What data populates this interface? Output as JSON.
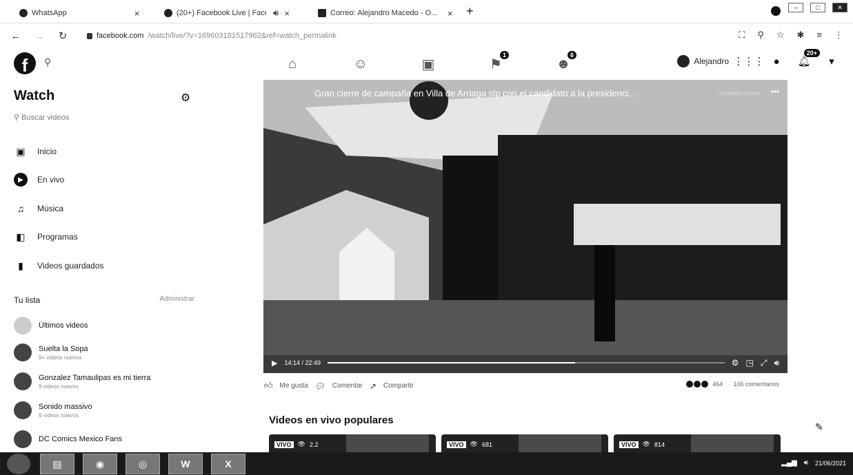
{
  "browser": {
    "tabs": [
      {
        "title": "WhatsApp",
        "close": "×"
      },
      {
        "title": "(20+) Facebook Live | Face",
        "close": "×"
      },
      {
        "title": "Correo: Alejandro Macedo - O...",
        "close": "×"
      }
    ],
    "new_tab": "+",
    "url_host": "facebook.com",
    "url_path": "/watch/live/?v=169603181517962&ref=watch_permalink"
  },
  "fb_nav": {
    "user_name": "Alejandro",
    "notification_badge": "20+",
    "groups_badge": "1",
    "gaming_badge": "6"
  },
  "sidebar": {
    "title": "Watch",
    "search_placeholder": "Buscar videos",
    "items": [
      {
        "label": "Inicio",
        "icon": "watch-home-icon"
      },
      {
        "label": "En vivo",
        "icon": "live-icon"
      },
      {
        "label": "Música",
        "icon": "music-icon"
      },
      {
        "label": "Programas",
        "icon": "shows-icon"
      },
      {
        "label": "Videos guardados",
        "icon": "bookmark-icon"
      }
    ],
    "your_list_label": "Tu lista",
    "manage_label": "Administrar",
    "list": [
      {
        "name": "Últimos videos",
        "sub": ""
      },
      {
        "name": "Suelta la Sopa",
        "sub": "9+ videos nuevos"
      },
      {
        "name": "Gonzalez Tamaulipas es mi tierra",
        "sub": "9 videos nuevos"
      },
      {
        "name": "Sonido massivo",
        "sub": "6 videos nuevos"
      },
      {
        "name": "DC Comics Mexico Fans",
        "sub": ""
      }
    ]
  },
  "video": {
    "title": "Gran cierre de campaña en Villa de Arriaga slp con el candidato a la presidenci...",
    "status": "Grabado en vivo",
    "time": "14:14 / 22:49",
    "progress": 0.623
  },
  "actions": {
    "like": "Me gusta",
    "comment": "Comentar",
    "share": "Compartir",
    "reaction_count": "464",
    "comments_count": "106 comentarios"
  },
  "popular": {
    "title": "Videos en vivo populares",
    "cards": [
      {
        "vivo": "VIVO",
        "viewers": "2.2"
      },
      {
        "vivo": "VIVO",
        "viewers": "681"
      },
      {
        "vivo": "VIVO",
        "viewers": "814"
      }
    ]
  },
  "taskbar": {
    "date": "21/06/2021"
  }
}
